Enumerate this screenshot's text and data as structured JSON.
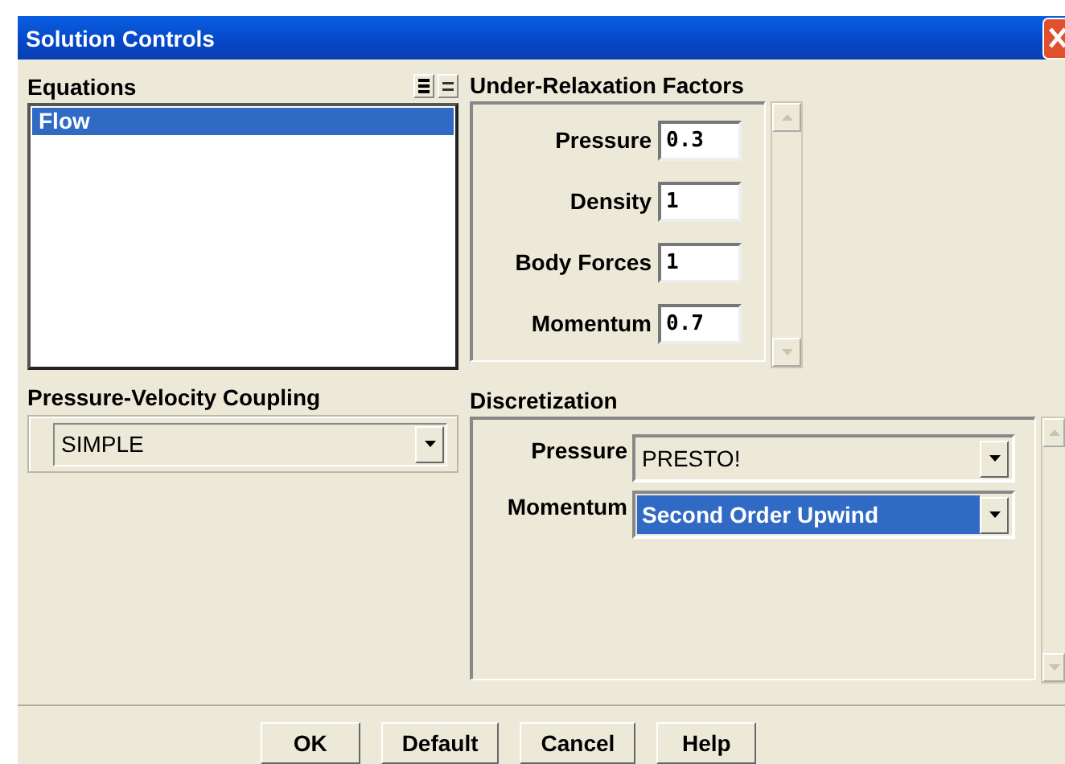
{
  "window": {
    "title": "Solution Controls"
  },
  "equations": {
    "label": "Equations",
    "items": [
      {
        "label": "Flow",
        "selected": true
      }
    ]
  },
  "coupling": {
    "label": "Pressure-Velocity Coupling",
    "value": "SIMPLE"
  },
  "relaxation": {
    "label": "Under-Relaxation Factors",
    "factors": [
      {
        "label": "Pressure",
        "value": "0.3"
      },
      {
        "label": "Density",
        "value": "1"
      },
      {
        "label": "Body Forces",
        "value": "1"
      },
      {
        "label": "Momentum",
        "value": "0.7"
      }
    ]
  },
  "discretization": {
    "label": "Discretization",
    "schemes": [
      {
        "label": "Pressure",
        "value": "PRESTO!",
        "selected": false
      },
      {
        "label": "Momentum",
        "value": "Second Order Upwind",
        "selected": true
      }
    ]
  },
  "buttons": [
    "OK",
    "Default",
    "Cancel",
    "Help"
  ]
}
